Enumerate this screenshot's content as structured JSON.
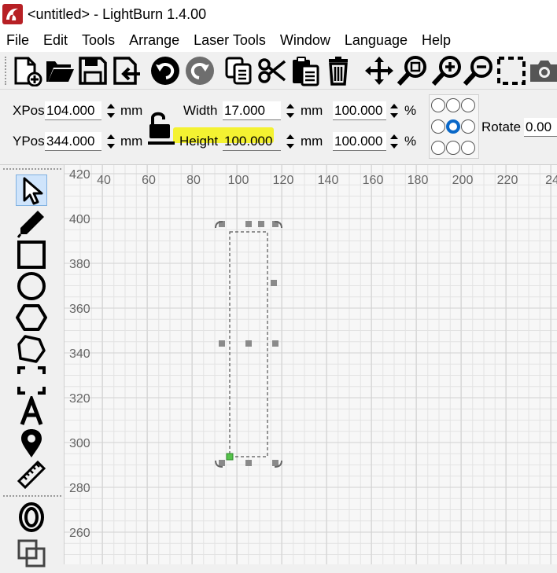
{
  "window": {
    "title": "<untitled> - LightBurn 1.4.00"
  },
  "menu": {
    "items": [
      "File",
      "Edit",
      "Tools",
      "Arrange",
      "Laser Tools",
      "Window",
      "Language",
      "Help"
    ]
  },
  "toolbar": {
    "icons": [
      "new-file-icon",
      "open-folder-icon",
      "save-icon",
      "import-icon",
      "undo-icon",
      "redo-icon",
      "copy-icon",
      "cut-icon",
      "paste-icon",
      "delete-icon",
      "move-icon",
      "zoom-fit-icon",
      "zoom-in-icon",
      "zoom-out-icon",
      "frame-selection-icon",
      "camera-icon"
    ]
  },
  "props": {
    "xpos_label": "XPos",
    "xpos_value": "104.000",
    "xpos_unit": "mm",
    "ypos_label": "YPos",
    "ypos_value": "344.000",
    "ypos_unit": "mm",
    "width_label": "Width",
    "width_value": "17.000",
    "width_unit": "mm",
    "width_pct": "100.000",
    "pct_sign": "%",
    "height_label": "Height",
    "height_value": "100.000",
    "height_unit": "mm",
    "height_pct": "100.000",
    "rotate_label": "Rotate",
    "rotate_value": "0.00",
    "highlight_color": "#f4f21c",
    "anchor_selected": "center"
  },
  "tools": [
    "select-arrow-icon",
    "pen-icon",
    "rectangle-icon",
    "ellipse-icon",
    "polygon-icon",
    "edit-nodes-icon",
    "trace-frame-icon",
    "text-icon",
    "position-laser-icon",
    "measure-icon",
    "offset-icon",
    "weld-icon"
  ],
  "canvas": {
    "x_ticks": [
      "40",
      "60",
      "80",
      "100",
      "120",
      "140",
      "160",
      "180",
      "200",
      "220",
      "24"
    ],
    "y_ticks": [
      "420",
      "400",
      "380",
      "360",
      "340",
      "320",
      "300",
      "280",
      "260"
    ],
    "selection_color": "#555555",
    "handle_color": "#8a8a8a",
    "origin_color": "#55c24a"
  }
}
